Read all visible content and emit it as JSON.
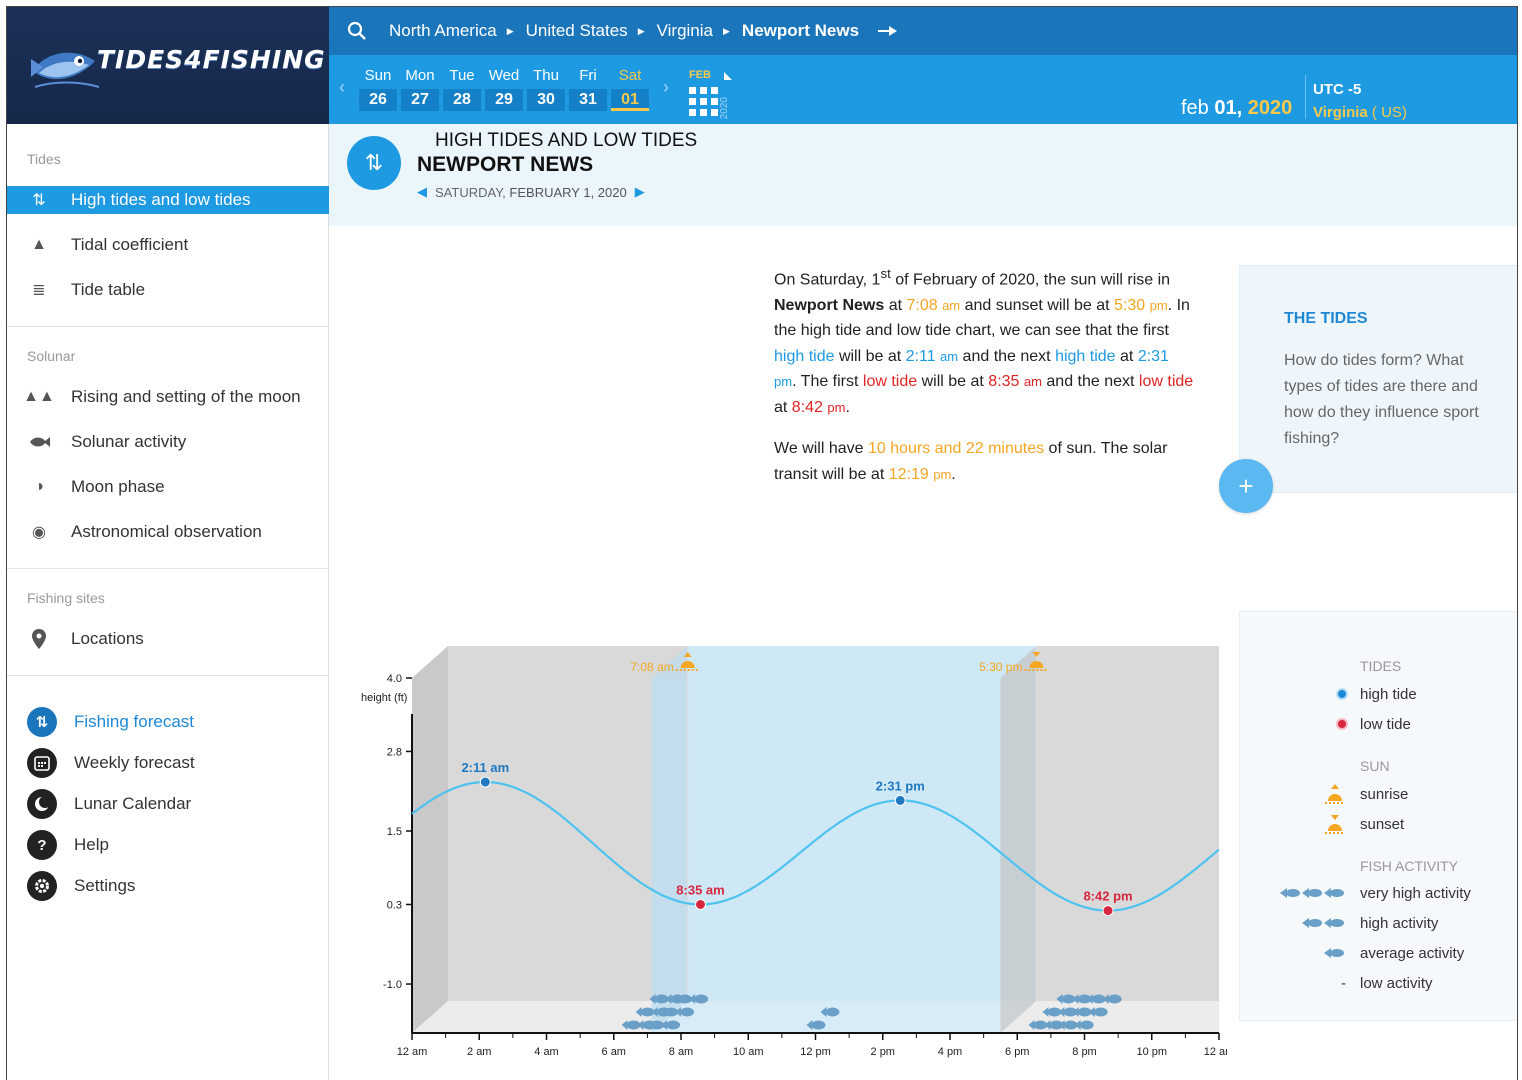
{
  "header": {
    "logo_text": "TIDES4FISHING",
    "breadcrumbs": [
      "North America",
      "United States",
      "Virginia",
      "Newport News"
    ]
  },
  "datebar": {
    "days": [
      {
        "name": "Sun",
        "num": "26"
      },
      {
        "name": "Mon",
        "num": "27"
      },
      {
        "name": "Tue",
        "num": "28"
      },
      {
        "name": "Wed",
        "num": "29"
      },
      {
        "name": "Thu",
        "num": "30"
      },
      {
        "name": "Fri",
        "num": "31"
      },
      {
        "name": "Sat",
        "num": "01"
      }
    ],
    "selected_day_index": 6,
    "calendar_month": "FEB",
    "calendar_year": "2020",
    "current_date_prefix": "feb",
    "current_date_day": "01,",
    "current_date_year": "2020",
    "utc_label": "UTC",
    "utc_offset": "-5",
    "state": "Virginia",
    "country": "( US)"
  },
  "sidebar": {
    "sections": {
      "tides": "Tides",
      "solunar": "Solunar",
      "fishing_sites": "Fishing sites"
    },
    "tides_items": [
      "High tides and low tides",
      "Tidal coefficient",
      "Tide table"
    ],
    "solunar_items": [
      "Rising and setting of the moon",
      "Solunar activity",
      "Moon phase",
      "Astronomical observation"
    ],
    "sites_items": [
      "Locations"
    ],
    "bottom_items": [
      "Fishing forecast",
      "Weekly forecast",
      "Lunar Calendar",
      "Help",
      "Settings"
    ]
  },
  "page": {
    "heading": "HIGH TIDES AND LOW TIDES",
    "location": "NEWPORT NEWS",
    "date_weekday": "SATURDAY,",
    "date_rest": "FEBRUARY 1, 2020"
  },
  "summary": {
    "p1_a": "On Saturday, 1",
    "p1_sup": "st",
    "p1_b": " of February of 2020, the sun will rise in ",
    "p1_place": "Newport News",
    "p1_c": " at ",
    "sunrise_time": "7:08",
    "sunrise_ampm": "am",
    "p1_d": " and sunset will be at ",
    "sunset_time": "5:30",
    "sunset_ampm": "pm",
    "p1_e": ". In the high tide and low tide chart, we can see that the first ",
    "high_tide_word": "high tide",
    "p1_f": " will be at ",
    "high1_time": "2:11",
    "high1_ampm": "am",
    "p1_g": " and the next ",
    "high_tide_word2": "high tide",
    "p1_h": " at ",
    "high2_time": "2:31",
    "high2_ampm": "pm",
    "p1_i": ". The first ",
    "low_tide_word": "low tide",
    "p1_j": " will be at ",
    "low1_time": "8:35",
    "low1_ampm": "am",
    "p1_k": " and the next ",
    "low_tide_word2": "low tide",
    "p1_l": " at ",
    "low2_time": "8:42",
    "low2_ampm": "pm",
    "p1_m": ".",
    "p2_a": "We will have ",
    "sun_duration": "10 hours and 22 minutes",
    "p2_b": " of sun. The solar transit will be at ",
    "transit_time": "12:19",
    "transit_ampm": "pm",
    "p2_c": "."
  },
  "tides_card": {
    "title": "THE TIDES",
    "text": "How do tides form? What types of tides are there and how do they influence sport fishing?",
    "expand": "+"
  },
  "legend": {
    "tides_title": "TIDES",
    "high": "high tide",
    "low": "low tide",
    "sun_title": "SUN",
    "sunrise": "sunrise",
    "sunset": "sunset",
    "fish_title": "FISH ACTIVITY",
    "very_high": "very high activity",
    "high_act": "high activity",
    "average": "average activity",
    "low_act": "low activity",
    "low_symbol": "-"
  },
  "chart_data": {
    "type": "line",
    "ylabel": "height (ft)",
    "yticks": [
      4.0,
      2.8,
      1.5,
      0.3,
      -1.0
    ],
    "ytick_labels": [
      "4.0",
      "2.8",
      "1.5",
      "0.3",
      "-1.0"
    ],
    "ylim": [
      -1.8,
      4.0
    ],
    "xlim": [
      0,
      24
    ],
    "xtick_labels": [
      "12 am",
      "2 am",
      "4 am",
      "6 am",
      "8 am",
      "10 am",
      "12 pm",
      "2 pm",
      "4 pm",
      "6 pm",
      "8 pm",
      "10 pm",
      "12 am"
    ],
    "sunrise": {
      "hour": 7.13,
      "label": "7:08 am"
    },
    "sunset": {
      "hour": 17.5,
      "label": "5:30 pm"
    },
    "series": [
      {
        "extrema": [
          {
            "hour": 2.18,
            "height": 2.3,
            "kind": "high",
            "label": "2:11 am"
          },
          {
            "hour": 8.58,
            "height": 0.3,
            "kind": "low",
            "label": "8:35 am"
          },
          {
            "hour": 14.52,
            "height": 2.0,
            "kind": "high",
            "label": "2:31 pm"
          },
          {
            "hour": 20.7,
            "height": 0.2,
            "kind": "low",
            "label": "8:42 pm"
          }
        ]
      }
    ],
    "fish_activity": [
      {
        "hour": 6.5,
        "level": 3
      },
      {
        "hour": 7.2,
        "level": 3
      },
      {
        "hour": 12.0,
        "level": 2
      },
      {
        "hour": 18.6,
        "level": 3
      },
      {
        "hour": 19.5,
        "level": 3
      }
    ],
    "colors": {
      "tide_line": "#4ec3f0",
      "high": "#1e78c2",
      "low": "#d7263d",
      "daylight": "#cfe8f5",
      "night": "#d9d9d9",
      "sun": "#f5a623"
    }
  }
}
